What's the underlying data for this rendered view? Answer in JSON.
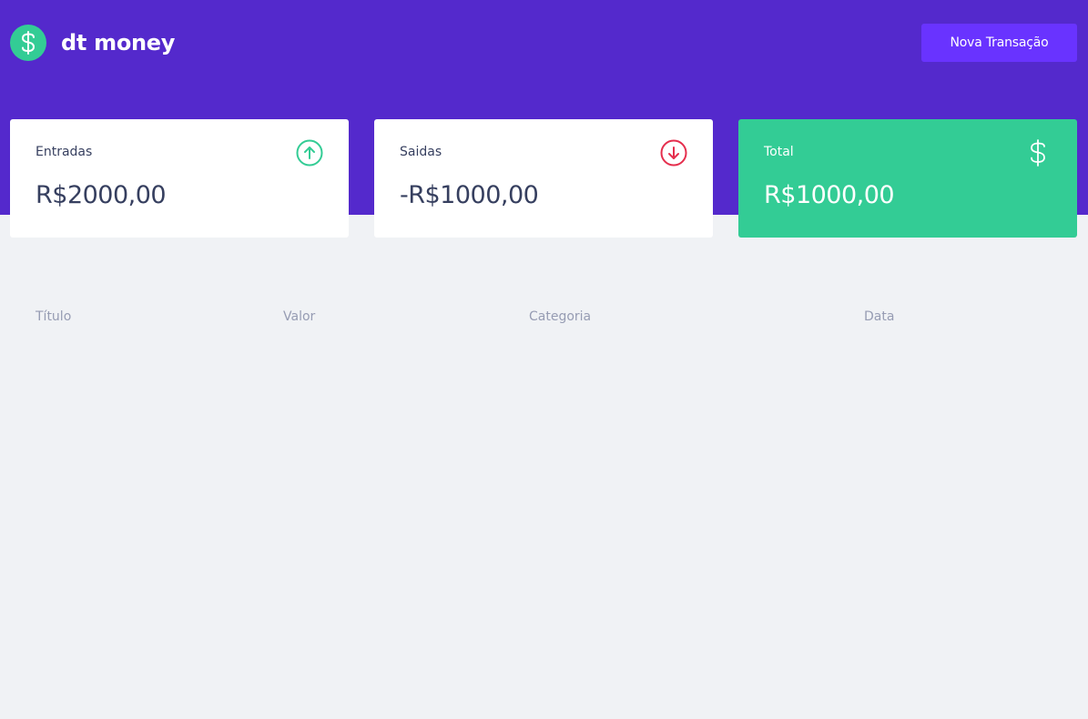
{
  "header": {
    "app_name": "dt money",
    "logo_icon": "dollar-icon",
    "new_transaction_label": "Nova Transação"
  },
  "summary": {
    "entradas": {
      "label": "Entradas",
      "value": "R$2000,00",
      "icon": "arrow-up-circle-icon",
      "color": "#33cc95"
    },
    "saidas": {
      "label": "Saidas",
      "value": "-R$1000,00",
      "icon": "arrow-down-circle-icon",
      "color": "#e52e4d"
    },
    "total": {
      "label": "Total",
      "value": "R$1000,00",
      "icon": "dollar-icon",
      "color": "#33cc95"
    }
  },
  "table": {
    "columns": [
      "Título",
      "Valor",
      "Categoria",
      "Data"
    ],
    "rows": []
  },
  "colors": {
    "header_bg": "#5429cc",
    "button_bg": "#6933ff",
    "page_bg": "#f0f2f5",
    "green": "#33cc95",
    "red": "#e52e4d",
    "text": "#363f5f",
    "muted": "#969cb3"
  }
}
